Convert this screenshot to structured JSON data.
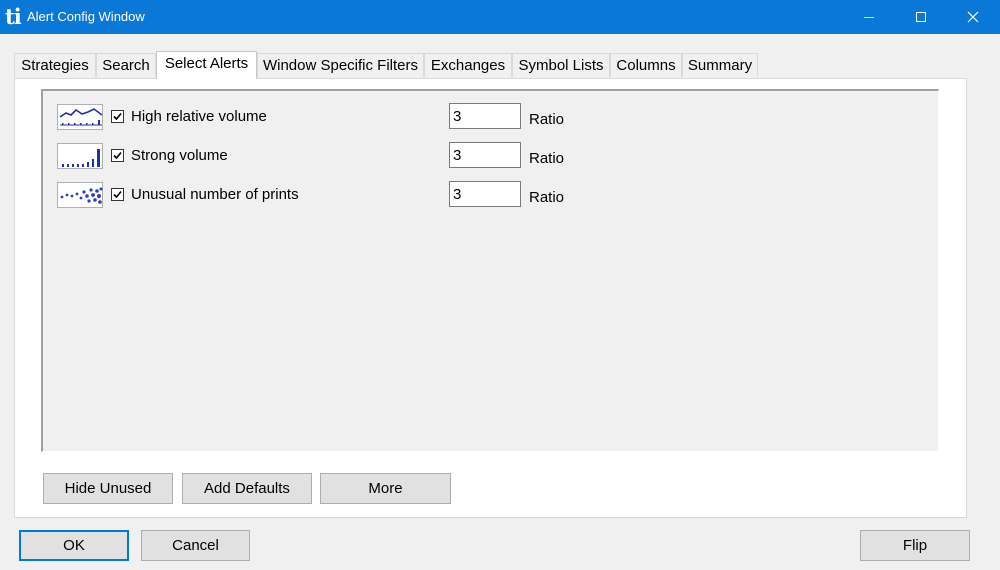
{
  "window": {
    "app_icon_text": "ti",
    "title": "Alert Config Window",
    "controls": [
      "minimize-icon",
      "maximize-icon",
      "close-icon"
    ]
  },
  "tabs": [
    {
      "label": "Strategies",
      "selected": false
    },
    {
      "label": "Search",
      "selected": false
    },
    {
      "label": "Select Alerts",
      "selected": true
    },
    {
      "label": "Window Specific Filters",
      "selected": false
    },
    {
      "label": "Exchanges",
      "selected": false
    },
    {
      "label": "Symbol Lists",
      "selected": false
    },
    {
      "label": "Columns",
      "selected": false
    },
    {
      "label": "Summary",
      "selected": false
    }
  ],
  "alerts": [
    {
      "icon": "relative-volume-chart-icon",
      "checked": true,
      "label": "High relative volume",
      "value": "3",
      "unit": "Ratio"
    },
    {
      "icon": "strong-volume-bars-icon",
      "checked": true,
      "label": "Strong volume",
      "value": "3",
      "unit": "Ratio"
    },
    {
      "icon": "prints-dots-icon",
      "checked": true,
      "label": "Unusual number of prints",
      "value": "3",
      "unit": "Ratio"
    }
  ],
  "panel_buttons": {
    "hide_unused": "Hide Unused",
    "add_defaults": "Add Defaults",
    "more": "More"
  },
  "dialog_buttons": {
    "ok": "OK",
    "cancel": "Cancel",
    "flip": "Flip"
  },
  "colors": {
    "titlebar": "#0a78d7",
    "thumb_ink": "#1f2fa8",
    "default_button_border": "#0078d7"
  }
}
